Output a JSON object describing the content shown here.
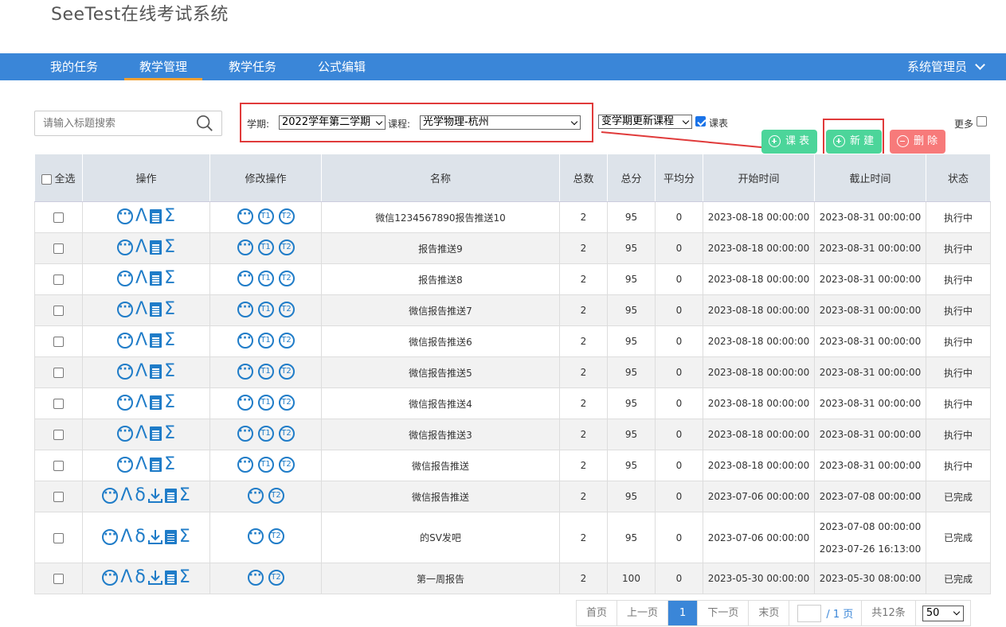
{
  "app_title": "SeeTest在线考试系统",
  "nav": {
    "items": [
      "我的任务",
      "教学管理",
      "教学任务",
      "公式编辑"
    ],
    "active": "教学管理",
    "user": "系统管理员"
  },
  "search": {
    "placeholder": "请输入标题搜索"
  },
  "filters": {
    "semester_label": "学期:",
    "semester_value": "2022学年第二学期",
    "course_label": "课程:",
    "course_value": "光学物理-杭州",
    "change_course": "变学期更新课程",
    "timetable_label": "课表",
    "timetable_checked": true,
    "more_label": "更多"
  },
  "buttons": {
    "timetable": "课 表",
    "create": "新 建",
    "delete": "删 除"
  },
  "table": {
    "headers": [
      "全选",
      "操作",
      "修改操作",
      "名称",
      "总数",
      "总分",
      "平均分",
      "开始时间",
      "截止时间",
      "状态"
    ],
    "rows": [
      {
        "name": "微信1234567890报告推送10",
        "total": "2",
        "score": "95",
        "avg": "0",
        "start": "2023-08-18 00:00:00",
        "end": "2023-08-31 00:00:00",
        "status": "执行中"
      },
      {
        "name": "报告推送9",
        "total": "2",
        "score": "95",
        "avg": "0",
        "start": "2023-08-18 00:00:00",
        "end": "2023-08-31 00:00:00",
        "status": "执行中"
      },
      {
        "name": "报告推送8",
        "total": "2",
        "score": "95",
        "avg": "0",
        "start": "2023-08-18 00:00:00",
        "end": "2023-08-31 00:00:00",
        "status": "执行中"
      },
      {
        "name": "微信报告推送7",
        "total": "2",
        "score": "95",
        "avg": "0",
        "start": "2023-08-18 00:00:00",
        "end": "2023-08-31 00:00:00",
        "status": "执行中"
      },
      {
        "name": "微信报告推送6",
        "total": "2",
        "score": "95",
        "avg": "0",
        "start": "2023-08-18 00:00:00",
        "end": "2023-08-31 00:00:00",
        "status": "执行中"
      },
      {
        "name": "微信报告推送5",
        "total": "2",
        "score": "95",
        "avg": "0",
        "start": "2023-08-18 00:00:00",
        "end": "2023-08-31 00:00:00",
        "status": "执行中"
      },
      {
        "name": "微信报告推送4",
        "total": "2",
        "score": "95",
        "avg": "0",
        "start": "2023-08-18 00:00:00",
        "end": "2023-08-31 00:00:00",
        "status": "执行中"
      },
      {
        "name": "微信报告推送3",
        "total": "2",
        "score": "95",
        "avg": "0",
        "start": "2023-08-18 00:00:00",
        "end": "2023-08-31 00:00:00",
        "status": "执行中"
      },
      {
        "name": "微信报告推送",
        "total": "2",
        "score": "95",
        "avg": "0",
        "start": "2023-08-18 00:00:00",
        "end": "2023-08-31 00:00:00",
        "status": "执行中"
      },
      {
        "name": "微信报告推送",
        "total": "2",
        "score": "95",
        "avg": "0",
        "start": "2023-07-06 00:00:00",
        "end": "2023-07-08 00:00:00",
        "status": "已完成"
      },
      {
        "name": "的SV发吧",
        "total": "2",
        "score": "95",
        "avg": "0",
        "start": "2023-07-06 00:00:00",
        "end": "2023-07-08 00:00:00",
        "end2": "2023-07-26 16:13:00",
        "status": "已完成"
      },
      {
        "name": "第一周报告",
        "total": "2",
        "score": "100",
        "avg": "0",
        "start": "2023-05-30 00:00:00",
        "end": "2023-05-30 08:00:00",
        "status": "已完成"
      }
    ]
  },
  "pager": {
    "first": "首页",
    "prev": "上一页",
    "current": "1",
    "next": "下一页",
    "last": "末页",
    "of_pages": "/ 1 页",
    "total": "共12条",
    "page_size": "50"
  }
}
